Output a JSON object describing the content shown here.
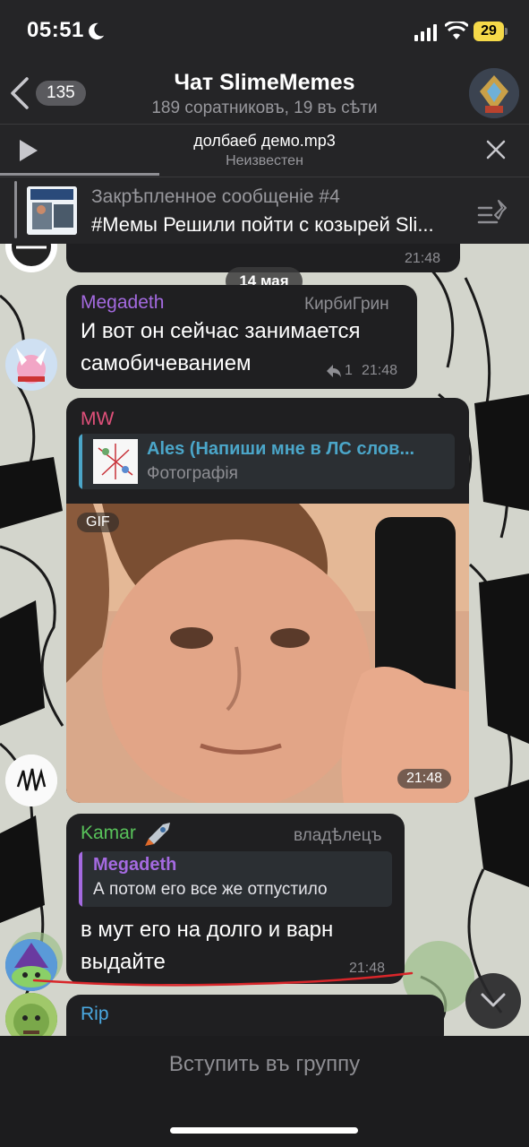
{
  "status_bar": {
    "time": "05:51",
    "battery": "29"
  },
  "header": {
    "back_count": "135",
    "title": "Чат SlimeMemes",
    "subtitle": "189 соратниковъ, 19 въ сѣти"
  },
  "player": {
    "track": "долбаеб демо.mp3",
    "artist": "Неизвестен"
  },
  "pinned": {
    "title": "Закрѣпленное сообщеніе #4",
    "text": "#Мемы Решили пойти с козырей Sli..."
  },
  "messages": {
    "first_time": "21:48",
    "date_label": "14 мая",
    "m1": {
      "sender": "Megadeth",
      "role": "КирбиГрин",
      "line1": "И вот он сейчас занимается",
      "line2": "самобичеванием",
      "reply_count": "1",
      "time": "21:48"
    },
    "m2": {
      "sender": "MW",
      "reply_sender": "Ales (Напиши мне в ЛС слов...",
      "reply_text": "Фотографія",
      "gif_label": "GIF",
      "time": "21:48"
    },
    "m3": {
      "sender": "Kamar",
      "role": "владѣлецъ",
      "reply_sender": "Megadeth",
      "reply_text": "А потом его все же отпустило",
      "line1": "в мут его на долго и варн",
      "line2": "выдайте",
      "time": "21:48"
    },
    "m4": {
      "sender": "Rip"
    }
  },
  "footer": {
    "join_label": "Вступить въ группу"
  },
  "colors": {
    "megadeth": "#a46ae0",
    "mw": "#e0507a",
    "ales": "#4ba6c9",
    "kamar": "#58c25a",
    "rip": "#4aa8e0"
  }
}
